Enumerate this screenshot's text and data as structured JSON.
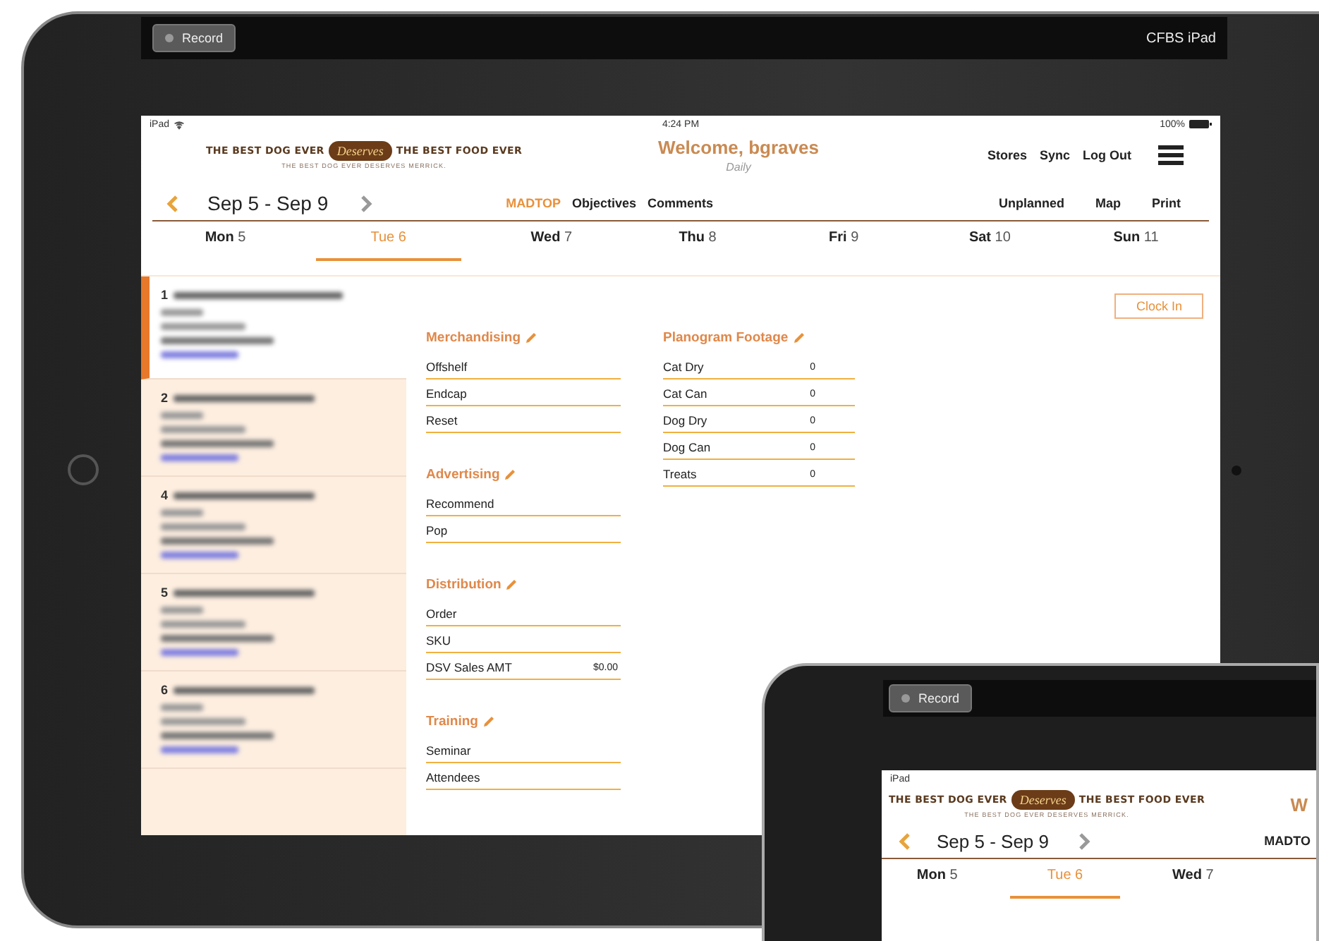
{
  "recorder": {
    "button": "Record",
    "device_name": "CFBS iPad"
  },
  "status_bar": {
    "carrier": "iPad",
    "time": "4:24 PM",
    "battery": "100%"
  },
  "logo": {
    "left": "THE BEST DOG EVER",
    "badge": "Deserves",
    "right": "THE BEST FOOD EVER",
    "tagline": "THE BEST DOG EVER DESERVES MERRICK."
  },
  "header": {
    "title": "Welcome, bgraves",
    "subtitle": "Daily",
    "links": [
      "Stores",
      "Sync",
      "Log Out"
    ]
  },
  "week": {
    "range": "Sep 5 - Sep 9"
  },
  "tabs": [
    {
      "label": "MADTOP",
      "selected": true
    },
    {
      "label": "Objectives",
      "selected": false
    },
    {
      "label": "Comments",
      "selected": false
    }
  ],
  "actions": [
    "Unplanned",
    "Map",
    "Print"
  ],
  "days": [
    {
      "name": "Mon",
      "date": "5",
      "selected": false
    },
    {
      "name": "Tue",
      "date": "6",
      "selected": true
    },
    {
      "name": "Wed",
      "date": "7",
      "selected": false
    },
    {
      "name": "Thu",
      "date": "8",
      "selected": false
    },
    {
      "name": "Fri",
      "date": "9",
      "selected": false
    },
    {
      "name": "Sat",
      "date": "10",
      "selected": false
    },
    {
      "name": "Sun",
      "date": "11",
      "selected": false
    }
  ],
  "stores": [
    {
      "number": "1",
      "selected": true
    },
    {
      "number": "2",
      "selected": false
    },
    {
      "number": "4",
      "selected": false
    },
    {
      "number": "5",
      "selected": false
    },
    {
      "number": "6",
      "selected": false
    }
  ],
  "clock_in": "Clock In",
  "columns": [
    [
      {
        "title": "Merchandising",
        "fields": [
          {
            "label": "Offshelf"
          },
          {
            "label": "Endcap"
          },
          {
            "label": "Reset"
          }
        ]
      },
      {
        "title": "Advertising",
        "fields": [
          {
            "label": "Recommend"
          },
          {
            "label": "Pop"
          }
        ]
      },
      {
        "title": "Distribution",
        "fields": [
          {
            "label": "Order"
          },
          {
            "label": "SKU"
          },
          {
            "label": "DSV Sales AMT",
            "value": "$0.00"
          }
        ]
      },
      {
        "title": "Training",
        "fields": [
          {
            "label": "Seminar"
          },
          {
            "label": "Attendees"
          }
        ]
      }
    ],
    [
      {
        "title": "Planogram Footage",
        "fields": [
          {
            "label": "Cat Dry",
            "value": "0"
          },
          {
            "label": "Cat Can",
            "value": "0"
          },
          {
            "label": "Dog Dry",
            "value": "0"
          },
          {
            "label": "Dog Can",
            "value": "0"
          },
          {
            "label": "Treats",
            "value": "0"
          }
        ]
      }
    ]
  ],
  "second_device": {
    "button": "Record",
    "carrier": "iPad",
    "logo": {
      "left": "THE BEST DOG EVER",
      "badge": "Deserves",
      "right": "THE BEST FOOD EVER",
      "tagline": "THE BEST DOG EVER DESERVES MERRICK."
    },
    "title": "W",
    "range": "Sep 5 - Sep 9",
    "tab": "MADTO",
    "days": [
      {
        "name": "Mon",
        "date": "5",
        "selected": false
      },
      {
        "name": "Tue",
        "date": "6",
        "selected": true
      },
      {
        "name": "Wed",
        "date": "7",
        "selected": false
      }
    ]
  }
}
